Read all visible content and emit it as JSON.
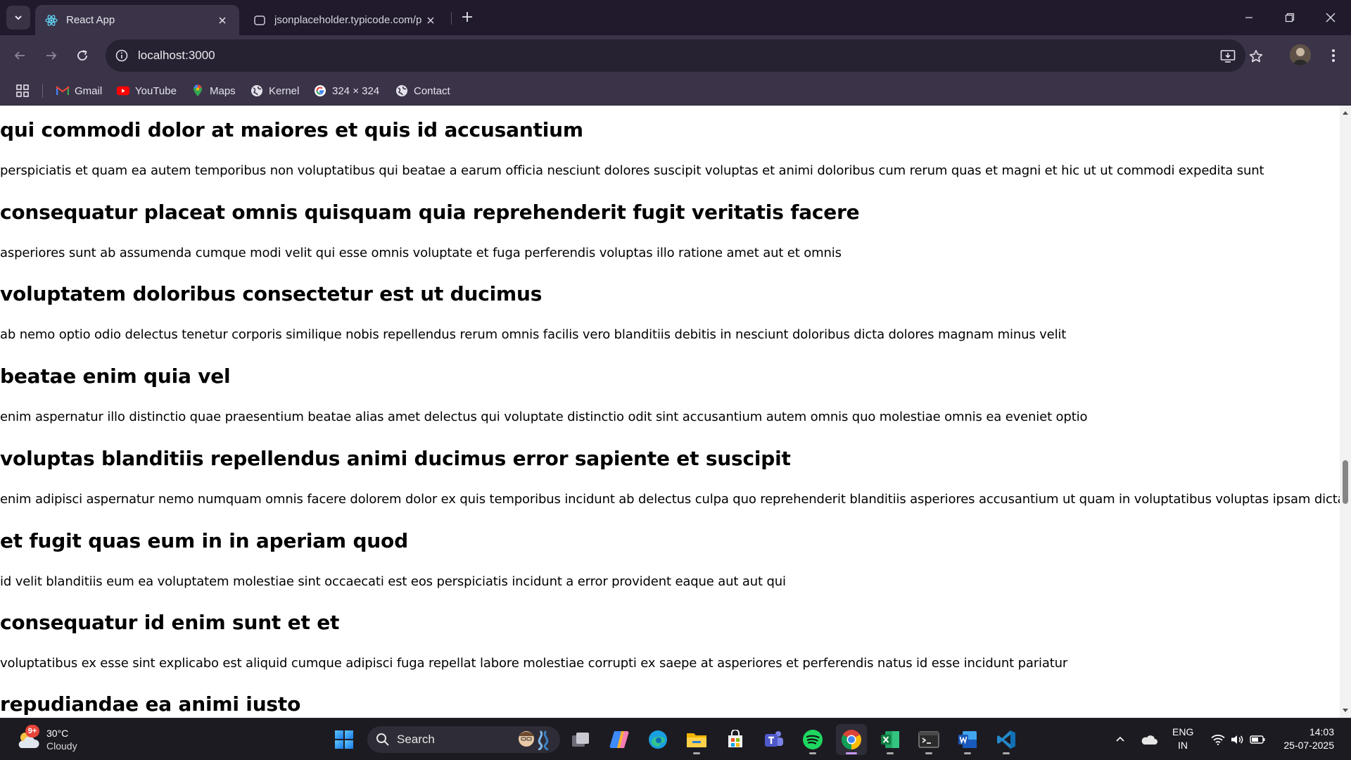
{
  "browser": {
    "tabs": [
      {
        "title": "React App",
        "active": true
      },
      {
        "title": "jsonplaceholder.typicode.com/p",
        "active": false
      }
    ],
    "address": "localhost:3000",
    "bookmarks": [
      {
        "label": "Gmail",
        "icon": "gmail-icon"
      },
      {
        "label": "YouTube",
        "icon": "youtube-icon"
      },
      {
        "label": "Maps",
        "icon": "maps-icon"
      },
      {
        "label": "Kernel",
        "icon": "globe-icon"
      },
      {
        "label": "324 × 324",
        "icon": "google-icon"
      },
      {
        "label": "Contact",
        "icon": "globe-icon"
      }
    ]
  },
  "posts": [
    {
      "title": "qui commodi dolor at maiores et quis id accusantium",
      "body": "perspiciatis et quam ea autem temporibus non voluptatibus qui beatae a earum officia nesciunt dolores suscipit voluptas et animi doloribus cum rerum quas et magni et hic ut ut commodi expedita sunt"
    },
    {
      "title": "consequatur placeat omnis quisquam quia reprehenderit fugit veritatis facere",
      "body": "asperiores sunt ab assumenda cumque modi velit qui esse omnis voluptate et fuga perferendis voluptas illo ratione amet aut et omnis"
    },
    {
      "title": "voluptatem doloribus consectetur est ut ducimus",
      "body": "ab nemo optio odio delectus tenetur corporis similique nobis repellendus rerum omnis facilis vero blanditiis debitis in nesciunt doloribus dicta dolores magnam minus velit"
    },
    {
      "title": "beatae enim quia vel",
      "body": "enim aspernatur illo distinctio quae praesentium beatae alias amet delectus qui voluptate distinctio odit sint accusantium autem omnis quo molestiae omnis ea eveniet optio"
    },
    {
      "title": "voluptas blanditiis repellendus animi ducimus error sapiente et suscipit",
      "body": "enim adipisci aspernatur nemo numquam omnis facere dolorem dolor ex quis temporibus incidunt ab delectus culpa quo reprehenderit blanditiis asperiores accusantium ut quam in voluptatibus voluptas ipsam dicta"
    },
    {
      "title": "et fugit quas eum in in aperiam quod",
      "body": "id velit blanditiis eum ea voluptatem molestiae sint occaecati est eos perspiciatis incidunt a error provident eaque aut aut qui"
    },
    {
      "title": "consequatur id enim sunt et et",
      "body": "voluptatibus ex esse sint explicabo est aliquid cumque adipisci fuga repellat labore molestiae corrupti ex saepe at asperiores et perferendis natus id esse incidunt pariatur"
    },
    {
      "title": "repudiandae ea animi iusto",
      "body": ""
    }
  ],
  "taskbar": {
    "weather": {
      "temp": "30°C",
      "condition": "Cloudy",
      "badge": "9+"
    },
    "search_label": "Search",
    "apps": [
      "start-icon",
      "task-view-icon",
      "copilot-icon",
      "edge-icon",
      "file-explorer-icon",
      "store-icon",
      "teams-icon",
      "spotify-icon",
      "chrome-icon",
      "excel-icon",
      "terminal-icon",
      "word-icon",
      "vscode-icon"
    ],
    "tray": {
      "lang_top": "ENG",
      "lang_bottom": "IN",
      "time": "14:03",
      "date": "25-07-2025"
    }
  },
  "colors": {
    "chrome_dark": "#201a2c",
    "chrome_toolbar": "#3b3449",
    "taskbar": "#1c1b22",
    "active_indicator": "#c89af0"
  }
}
